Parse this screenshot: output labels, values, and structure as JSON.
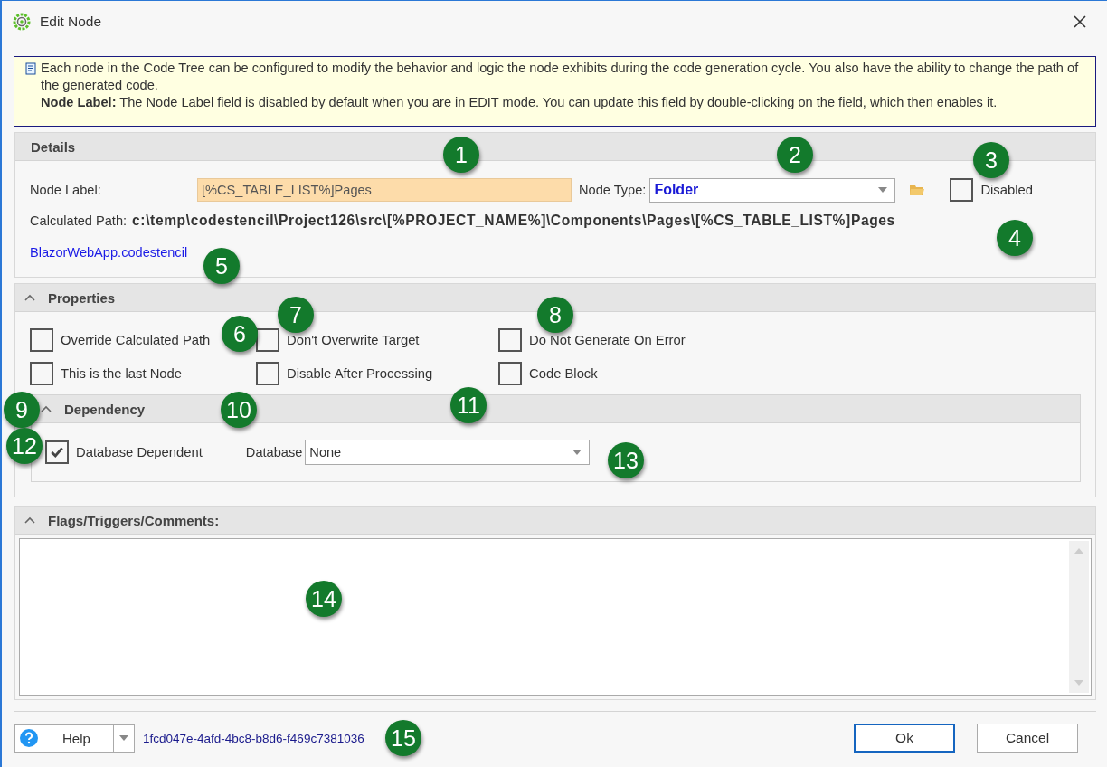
{
  "window": {
    "title": "Edit Node"
  },
  "info": {
    "lines": [
      "Each node in the Code Tree can be configured to modify the behavior and logic the node exhibits during the code generation cycle. You also have the ability to change the path of the generated code.",
      "**Node Label:** The Node Label field is disabled by default when you are in EDIT mode. You can update this field by double-clicking on the field, which then enables it."
    ]
  },
  "details": {
    "title": "Details",
    "node_label": {
      "label": "Node Label:",
      "value": "[%CS_TABLE_LIST%]Pages"
    },
    "node_type": {
      "label": "Node Type:",
      "value": "Folder"
    },
    "disabled": {
      "label": "Disabled",
      "checked": false
    },
    "calculated_path": {
      "label": "Calculated Path:",
      "value": "c:\\temp\\codestencil\\Project126\\src\\[%PROJECT_NAME%]\\Components\\Pages\\[%CS_TABLE_LIST%]Pages"
    },
    "template_link": "BlazorWebApp.codestencil"
  },
  "properties": {
    "title": "Properties",
    "expanded": true,
    "options": [
      {
        "label": "Override Calculated Path",
        "checked": false
      },
      {
        "label": "Don't Overwrite Target",
        "checked": false
      },
      {
        "label": "Do Not Generate On Error",
        "checked": false
      },
      {
        "label": "This is the last Node",
        "checked": false
      },
      {
        "label": "Disable After Processing",
        "checked": false
      },
      {
        "label": "Code Block",
        "checked": false
      }
    ],
    "dependency": {
      "title": "Dependency",
      "expanded": true,
      "database_dependent": {
        "label": "Database Dependent",
        "checked": true
      },
      "database": {
        "label": "Database",
        "value": "None"
      }
    }
  },
  "comments": {
    "title": "Flags/Triggers/Comments:",
    "expanded": true
  },
  "footer": {
    "help": "Help",
    "node_id": "1fcd047e-4afd-4bc8-b8d6-f469c7381036",
    "buttons": [
      {
        "label": "Ok",
        "default": true
      },
      {
        "label": "Cancel",
        "default": false
      }
    ]
  },
  "callouts": [
    "1",
    "2",
    "3",
    "4",
    "5",
    "6",
    "7",
    "8",
    "9",
    "10",
    "11",
    "12",
    "13",
    "14",
    "15"
  ]
}
